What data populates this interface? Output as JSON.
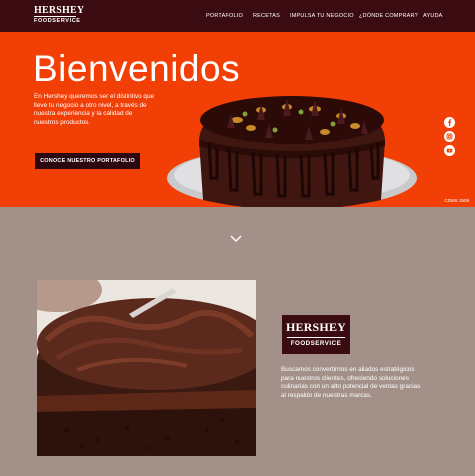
{
  "header": {
    "logo": {
      "brand": "HERSHEY",
      "sub": "FOODSERVICE"
    },
    "nav": [
      "PORTAFOLIO",
      "RECETAS",
      "IMPULSA TU NEGOCIO",
      "¿DÓNDE COMPRAR?",
      "AYUDA"
    ]
  },
  "hero": {
    "title": "Bienvenidos",
    "text": "En Hershey queremos ser el distintivo que lleve tu negocio a otro nivel, a través de nuestra experiencia y la calidad de nuestros productos.",
    "button": "CONOCE NUESTRO PORTAFOLIO",
    "code": "CDMS 1509",
    "social": [
      "facebook-icon",
      "instagram-icon",
      "youtube-icon"
    ]
  },
  "about": {
    "logo": {
      "brand": "HERSHEY",
      "sub": "FOODSERVICE"
    },
    "text": "Buscamos convertirnos en aliados estratégicos para nuestros clientes, ofreciendo soluciones culinarias con un alto potencial de ventas gracias al respaldo de nuestras marcas."
  },
  "colors": {
    "header_bg": "#3a0c12",
    "hero_bg": "#f23f05",
    "section_bg": "#a39189",
    "button_bg": "#2b0810"
  }
}
